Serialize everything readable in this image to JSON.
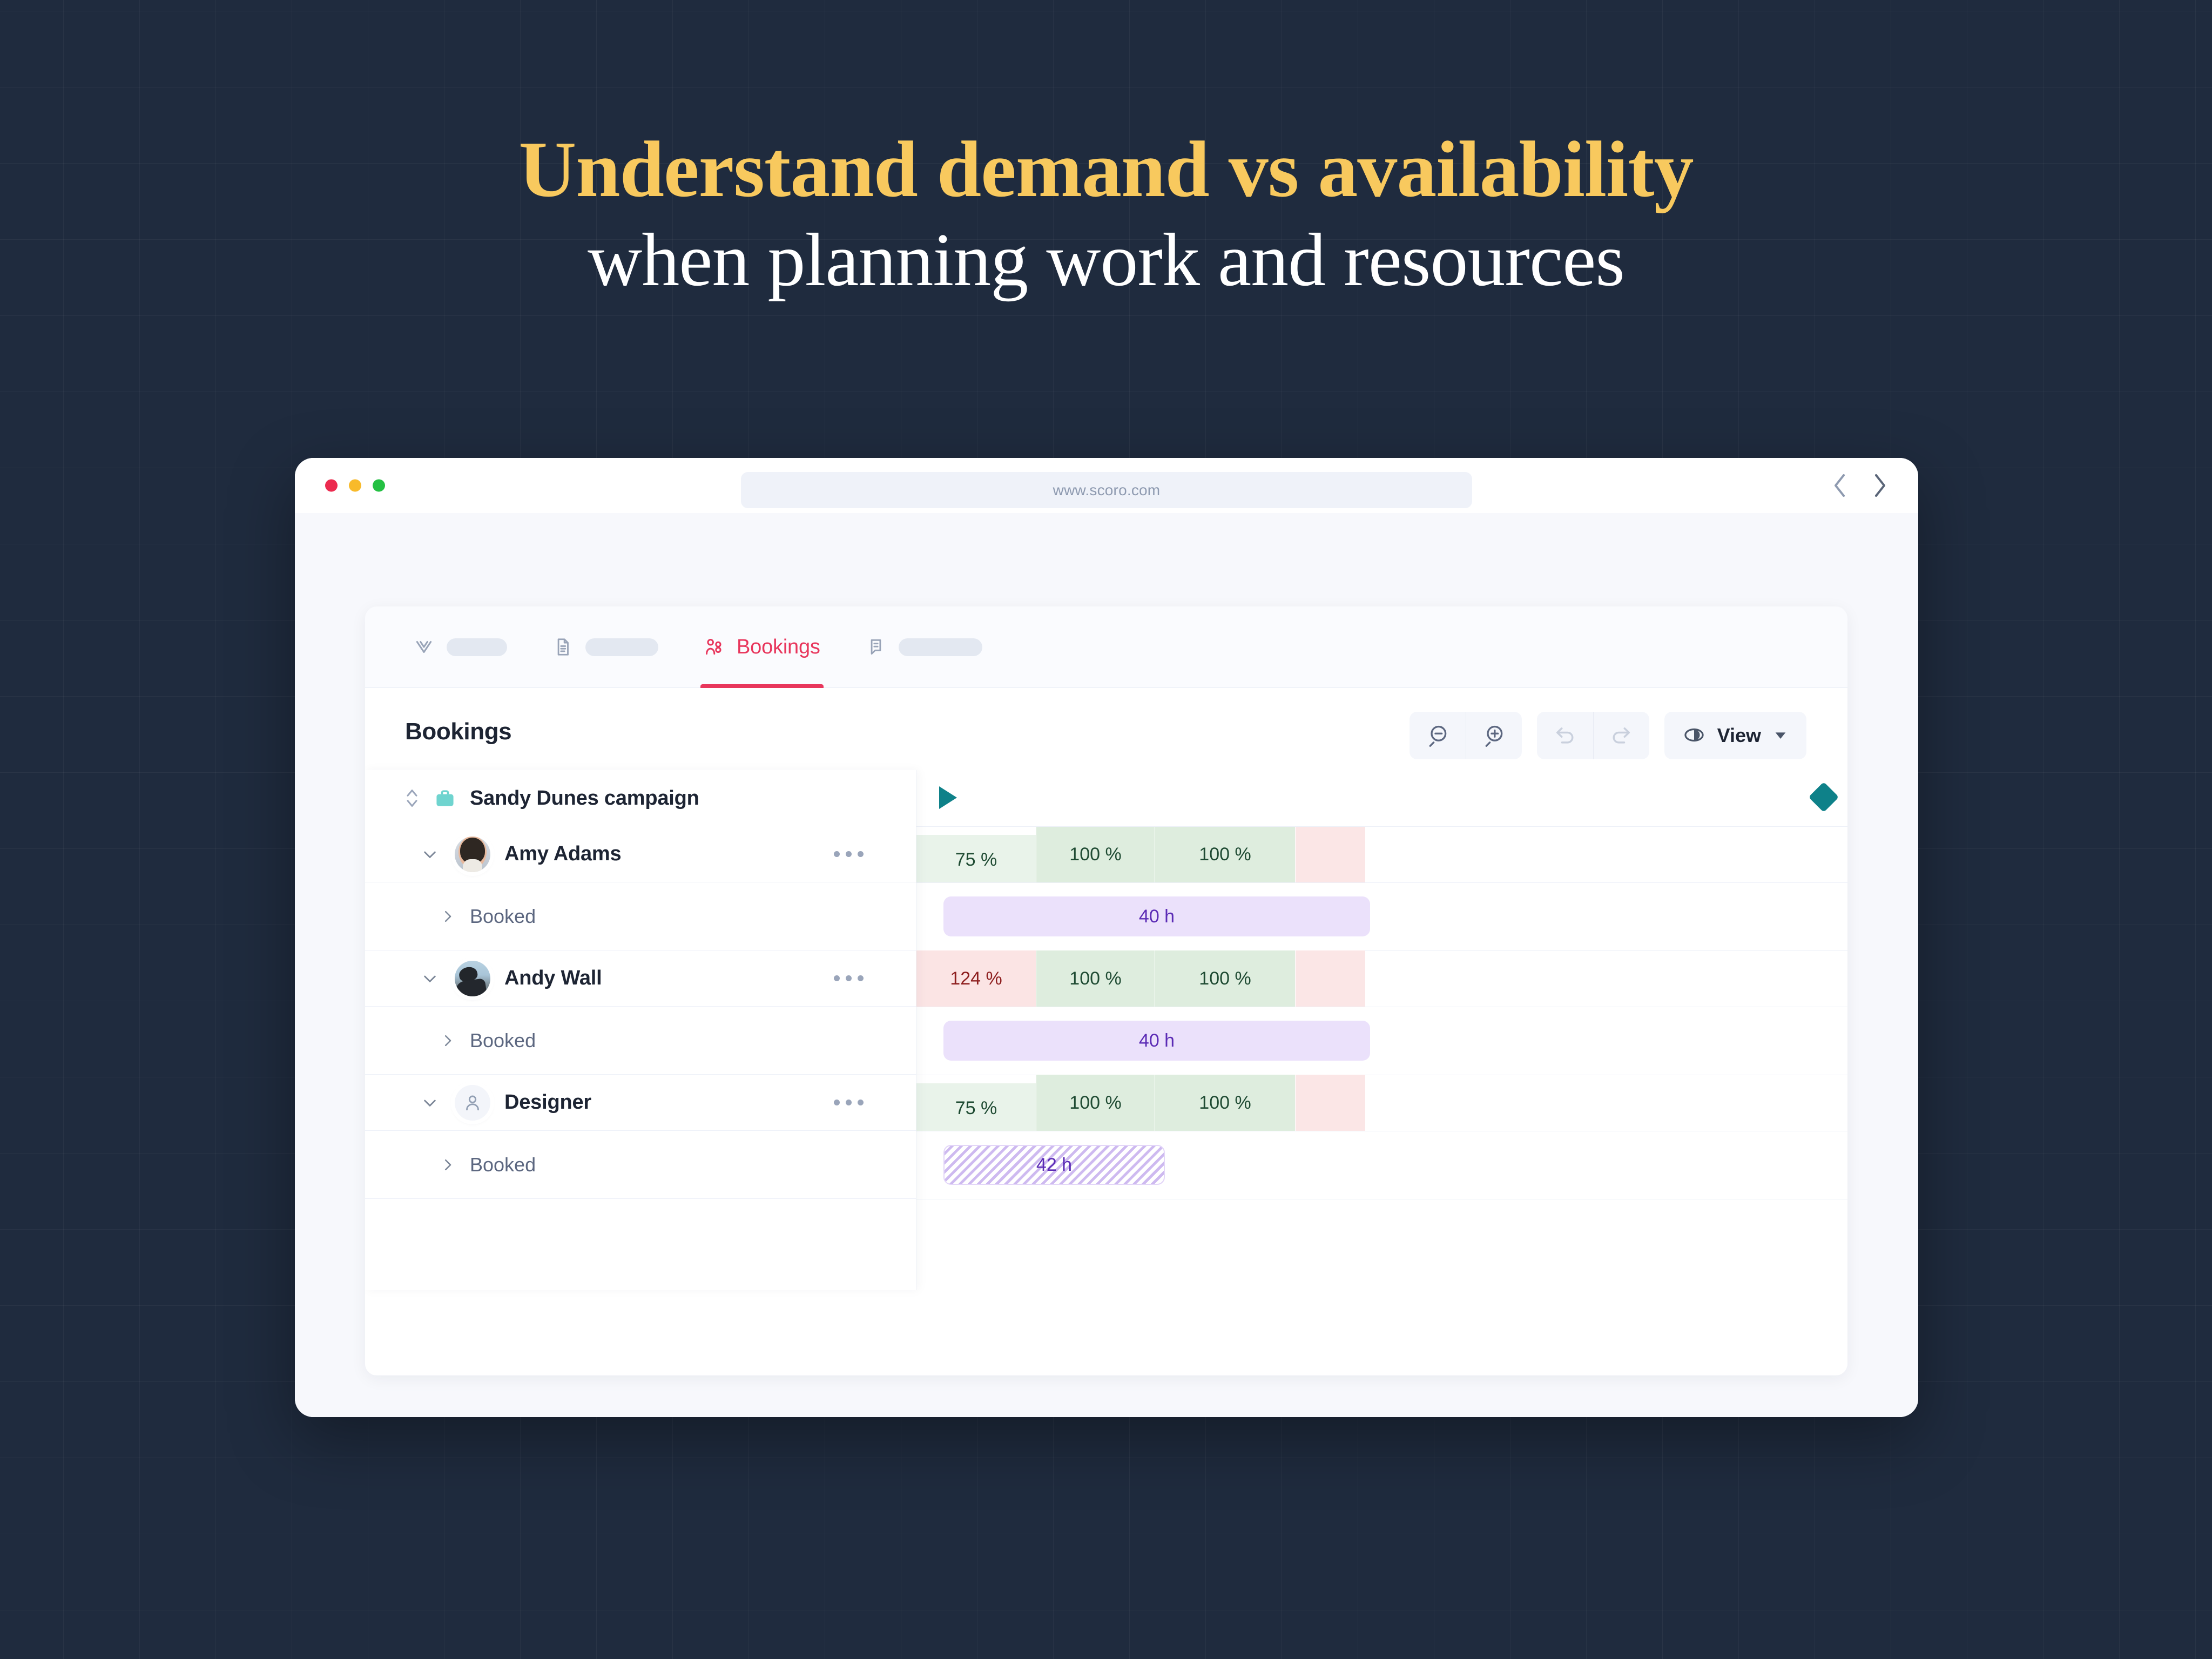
{
  "hero": {
    "line1": "Understand demand vs availability",
    "line2": "when planning work and resources"
  },
  "browser": {
    "url": "www.scoro.com",
    "traffic_lights": [
      "close",
      "minimize",
      "maximize"
    ],
    "nav_back_icon": "chevron-left-icon",
    "nav_forward_icon": "chevron-right-icon"
  },
  "tabs": [
    {
      "id": "tab-1",
      "icon": "checkmark-icon",
      "label": "",
      "active": false
    },
    {
      "id": "tab-2",
      "icon": "document-icon",
      "label": "",
      "active": false
    },
    {
      "id": "tab-3",
      "icon": "bookings-icon",
      "label": "Bookings",
      "active": true
    },
    {
      "id": "tab-4",
      "icon": "comment-icon",
      "label": "",
      "active": false
    }
  ],
  "page": {
    "title": "Bookings"
  },
  "toolbar": {
    "zoom_out_label": "Zoom out",
    "zoom_in_label": "Zoom in",
    "undo_label": "Undo",
    "redo_label": "Redo",
    "view_label": "View"
  },
  "project": {
    "name": "Sandy Dunes campaign",
    "icon": "briefcase-icon",
    "sort_icon": "sort-updown-icon",
    "start_marker": "play-triangle-marker",
    "end_marker": "diamond-milestone-marker"
  },
  "rows": [
    {
      "type": "person",
      "name": "Amy Adams",
      "avatar": "photo-woman",
      "menu_icon": "kebab-menu-icon",
      "expand_icon": "chevron-down-icon",
      "utilization": [
        {
          "value": "75 %",
          "state": "partial-green"
        },
        {
          "value": "100 %",
          "state": "green"
        },
        {
          "value": "100 %",
          "state": "green"
        },
        {
          "value": "",
          "state": "red"
        }
      ],
      "child": {
        "label": "Booked",
        "expand_icon": "chevron-right-icon",
        "bar": {
          "value": "40 h",
          "style": "solid"
        }
      }
    },
    {
      "type": "person",
      "name": "Andy Wall",
      "avatar": "photo-cyclist",
      "menu_icon": "kebab-menu-icon",
      "expand_icon": "chevron-down-icon",
      "utilization": [
        {
          "value": "124 %",
          "state": "over-red"
        },
        {
          "value": "100 %",
          "state": "green"
        },
        {
          "value": "100 %",
          "state": "green"
        },
        {
          "value": "",
          "state": "red"
        }
      ],
      "child": {
        "label": "Booked",
        "expand_icon": "chevron-right-icon",
        "bar": {
          "value": "40 h",
          "style": "solid"
        }
      }
    },
    {
      "type": "person",
      "name": "Designer",
      "avatar": "generic-person-icon",
      "menu_icon": "kebab-menu-icon",
      "expand_icon": "chevron-down-icon",
      "utilization": [
        {
          "value": "75 %",
          "state": "partial-green"
        },
        {
          "value": "100 %",
          "state": "green"
        },
        {
          "value": "100 %",
          "state": "green"
        },
        {
          "value": "",
          "state": "red"
        }
      ],
      "child": {
        "label": "Booked",
        "expand_icon": "chevron-right-icon",
        "bar": {
          "value": "42 h",
          "style": "striped"
        }
      }
    }
  ],
  "colors": {
    "background": "#1F2B3E",
    "accent_yellow": "#F8C95E",
    "accent_red": "#E8365C",
    "teal": "#0E8189",
    "purple_bar": "#EBE1FB",
    "purple_text": "#5B2BB5",
    "green_cell": "#DEEDDE",
    "green_cell_light": "#E9F3EA",
    "red_cell": "#FBE4E4"
  }
}
